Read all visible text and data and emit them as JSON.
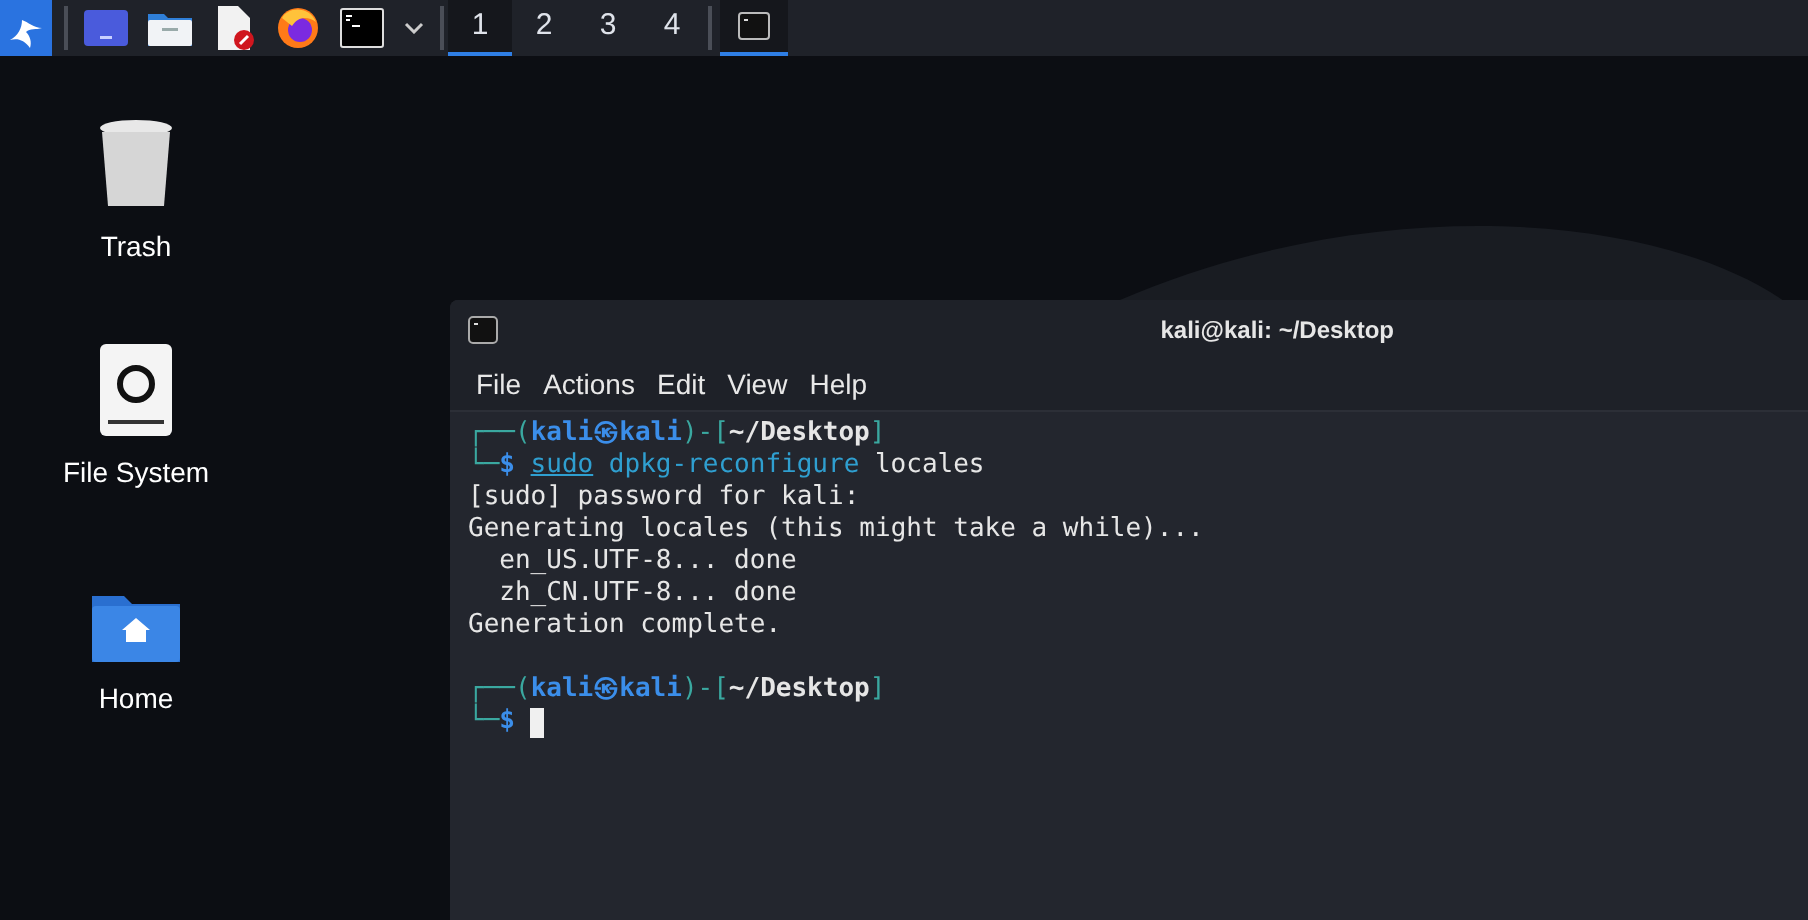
{
  "taskbar": {
    "launchers": [
      {
        "kind": "desktop"
      },
      {
        "kind": "files"
      },
      {
        "kind": "editor"
      },
      {
        "kind": "browser"
      },
      {
        "kind": "terminal"
      }
    ],
    "workspaces": [
      {
        "label": "1",
        "selected": true
      },
      {
        "label": "2",
        "selected": false
      },
      {
        "label": "3",
        "selected": false
      },
      {
        "label": "4",
        "selected": false
      }
    ],
    "windows": [
      {
        "kind": "terminal",
        "selected": true
      }
    ]
  },
  "desktop_icons": [
    {
      "kind": "trash",
      "label": "Trash"
    },
    {
      "kind": "drive",
      "label": "File System"
    },
    {
      "kind": "home",
      "label": "Home"
    }
  ],
  "terminal": {
    "title": "kali@kali: ~/Desktop",
    "menu": [
      "File",
      "Actions",
      "Edit",
      "View",
      "Help"
    ],
    "lines": [
      {
        "kind": "text",
        "segments": [
          {
            "kind": "frame",
            "text": "┌──("
          },
          {
            "kind": "user",
            "text": "kali㉿kali"
          },
          {
            "kind": "frame",
            "text": ")-["
          },
          {
            "kind": "path",
            "text": "~/Desktop"
          },
          {
            "kind": "frame",
            "text": "]"
          }
        ]
      },
      {
        "kind": "text",
        "segments": [
          {
            "kind": "frame",
            "text": "└─"
          },
          {
            "kind": "user",
            "text": "$"
          },
          {
            "kind": "sudo",
            "text": "sudo"
          },
          {
            "kind": "command",
            "text": "dpkg-reconfigure"
          },
          {
            "kind": "argument",
            "text": "locales"
          }
        ]
      },
      {
        "kind": "text",
        "segments": [
          {
            "kind": "plain",
            "text": "[sudo] password for kali:"
          }
        ]
      },
      {
        "kind": "text",
        "segments": [
          {
            "kind": "plain",
            "text": "Generating locales (this might take a while)..."
          }
        ]
      },
      {
        "kind": "text",
        "segments": [
          {
            "kind": "plain",
            "text": "  en_US.UTF-8... done"
          }
        ]
      },
      {
        "kind": "text",
        "segments": [
          {
            "kind": "plain",
            "text": "  zh_CN.UTF-8... done"
          }
        ]
      },
      {
        "kind": "text",
        "segments": [
          {
            "kind": "plain",
            "text": "Generation complete."
          }
        ]
      },
      {
        "kind": "blank"
      },
      {
        "kind": "text",
        "segments": [
          {
            "kind": "frame",
            "text": "┌──("
          },
          {
            "kind": "user",
            "text": "kali㉿kali"
          },
          {
            "kind": "frame",
            "text": ")-["
          },
          {
            "kind": "path",
            "text": "~/Desktop"
          },
          {
            "kind": "frame",
            "text": "]"
          }
        ]
      },
      {
        "kind": "text",
        "segments": [
          {
            "kind": "frame",
            "text": "└─"
          },
          {
            "kind": "user",
            "text": "$"
          },
          {
            "kind": "cursor"
          }
        ]
      }
    ]
  }
}
